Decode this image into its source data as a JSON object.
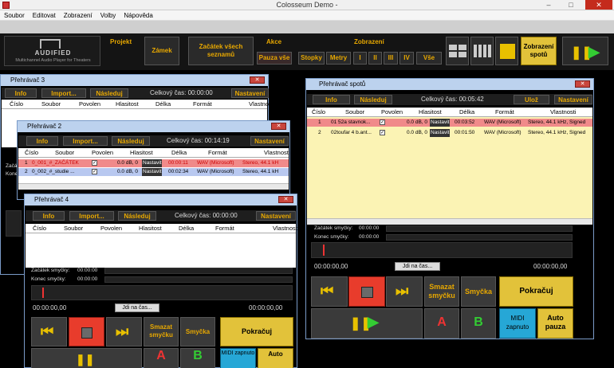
{
  "window_title": "Colosseum Demo -",
  "menu": [
    "Soubor",
    "Editovat",
    "Zobrazení",
    "Volby",
    "Nápověda"
  ],
  "window_controls": {
    "minimize": "–",
    "maximize": "□",
    "close": "✕"
  },
  "logo": {
    "brand": "AUDIFIED",
    "tagline": "Multichannel Audio Player for Theaters"
  },
  "toolbar": {
    "projekt_label": "Projekt",
    "zamek": "Zámek",
    "zacatek": "Začátek všech seznamů",
    "akce_label": "Akce",
    "pauza_vse": "Pauza vše",
    "zobrazeni_label": "Zobrazení",
    "stopky": "Stopky",
    "metry": "Metry",
    "views": [
      "I",
      "II",
      "III",
      "IV",
      "Vše"
    ],
    "zobrazeni_spotu": "Zobrazení spotů"
  },
  "common": {
    "info": "Info",
    "import": "Import...",
    "nasleduj": "Následuj",
    "nastaveni": "Nastavení",
    "uloz": "Ulož",
    "cols": [
      "Číslo",
      "Soubor",
      "Povolen",
      "Hlasitost",
      "Délka",
      "Formát",
      "Vlastnosti"
    ],
    "loop_start": "Začátek smyčky:",
    "loop_end": "Konec smyčky:",
    "jdi_na_cas": "Jdi na čas...",
    "smazat_smycku": "Smazat smyčku",
    "smycka": "Smyčka",
    "pokracuj": "Pokračuj",
    "midi": "MIDI zapnuto",
    "auto_pauza": "Auto pauza",
    "a": "A",
    "b": "B",
    "auto": "Auto"
  },
  "p3": {
    "title": "Přehrávač 3",
    "total": "Celkový čas: 00:00:00",
    "loop_start_lbl": "Začátek smyčky:",
    "loop_end_lbl": "Konec smyčky:"
  },
  "p2": {
    "title": "Přehrávač 2",
    "total": "Celkový čas: 00:14:19",
    "rows": [
      {
        "num": "1",
        "file": "0_001_#_ZAČÁTEK",
        "vol": "0.0 dB, 0",
        "tag": "Nastavit",
        "len": "00:00:11",
        "fmt": "WAV (Microsoft)",
        "prop": "Stereo, 44.1 kH"
      },
      {
        "num": "2",
        "file": "0_002_#_studie ...",
        "vol": "0.0 dB, 0",
        "tag": "Nastavit",
        "len": "00:02:34",
        "fmt": "WAV (Microsoft)",
        "prop": "Stereo, 44.1 kH"
      }
    ],
    "loop_start": "Začátek smyčky:",
    "loop_end": "Konec smyčky:"
  },
  "p4": {
    "title": "Přehrávač 4",
    "total": "Celkový čas: 00:00:00",
    "time_start": "00:00:00",
    "time_end": "00:00:00",
    "pos_left": "00:00:00,00",
    "pos_right": "00:00:00,00"
  },
  "spots": {
    "title": "Přehrávač spotů",
    "total": "Celkový čas: 00:05:42",
    "rows": [
      {
        "num": "1",
        "file": "01 52a stavnok...",
        "vol": "0.0 dB, 0",
        "tag": "Nastavit",
        "len": "00:03:52",
        "fmt": "WAV (Microsoft)",
        "prop": "Stereo, 44.1 kHz, Signed"
      },
      {
        "num": "2",
        "file": "02toufar 4 b.ant...",
        "vol": "0.0 dB, 0",
        "tag": "Nastavit",
        "len": "00:01:50",
        "fmt": "WAV (Microsoft)",
        "prop": "Stereo, 44.1 kHz, Signed"
      }
    ],
    "time_start": "00:00:00",
    "time_end": "00:00:00",
    "pos_left": "00:00:00,00",
    "pos_right": "00:00:00,00"
  },
  "colors": {
    "accent": "#e8a800",
    "yellow": "#e2c23a",
    "red": "#e83c2c",
    "cyan": "#26a7d6",
    "selected_row": "#f08a8a",
    "row2": "#b8c8f0",
    "spot_bg": "#fbf3b4"
  }
}
